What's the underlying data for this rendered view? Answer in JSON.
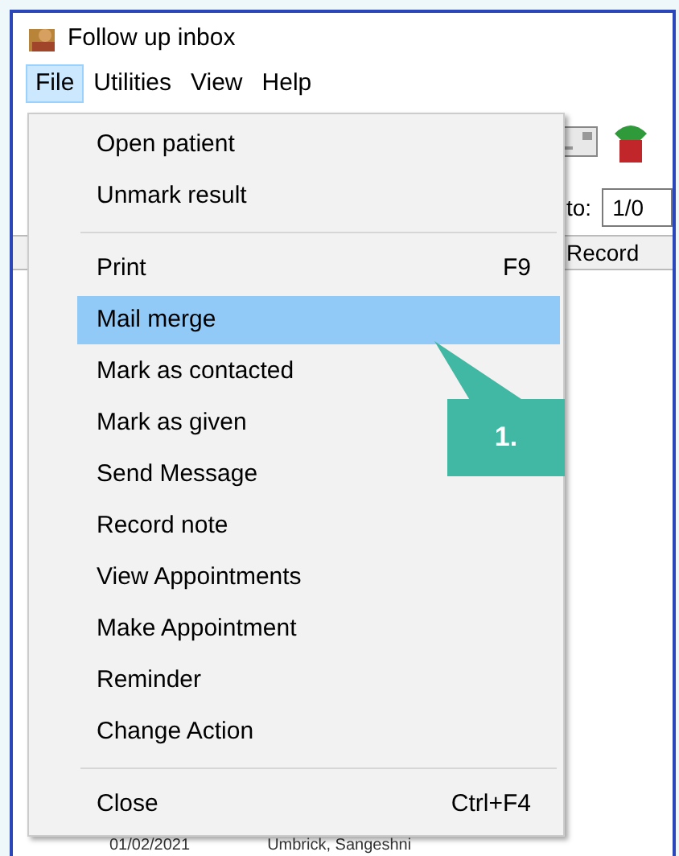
{
  "window": {
    "title": "Follow up inbox"
  },
  "menu_bar": [
    {
      "label": "File",
      "selected": true
    },
    {
      "label": "Utilities",
      "selected": false
    },
    {
      "label": "View",
      "selected": false
    },
    {
      "label": "Help",
      "selected": false
    }
  ],
  "filter": {
    "label": "to:",
    "value": "1/0"
  },
  "table": {
    "columns": [
      "Record"
    ],
    "rows": [
      [
        "01/02/2021",
        "Umbrick, Sangeshni"
      ]
    ]
  },
  "file_menu": [
    {
      "kind": "item",
      "label": "Open patient",
      "selected": false
    },
    {
      "kind": "item",
      "label": "Unmark result",
      "selected": false
    },
    {
      "kind": "separator"
    },
    {
      "kind": "item",
      "label": "Print",
      "shortcut": "F9",
      "selected": false
    },
    {
      "kind": "item",
      "label": "Mail merge",
      "selected": true
    },
    {
      "kind": "item",
      "label": "Mark as contacted",
      "selected": false
    },
    {
      "kind": "item",
      "label": "Mark as given",
      "selected": false
    },
    {
      "kind": "item",
      "label": "Send Message",
      "selected": false
    },
    {
      "kind": "item",
      "label": "Record note",
      "selected": false
    },
    {
      "kind": "item",
      "label": "View Appointments",
      "selected": false
    },
    {
      "kind": "item",
      "label": "Make Appointment",
      "selected": false
    },
    {
      "kind": "item",
      "label": "Reminder",
      "selected": false
    },
    {
      "kind": "item",
      "label": "Change Action",
      "selected": false
    },
    {
      "kind": "separator"
    },
    {
      "kind": "item",
      "label": "Close",
      "shortcut": "Ctrl+F4",
      "selected": false
    }
  ],
  "callout": {
    "label": "1."
  }
}
